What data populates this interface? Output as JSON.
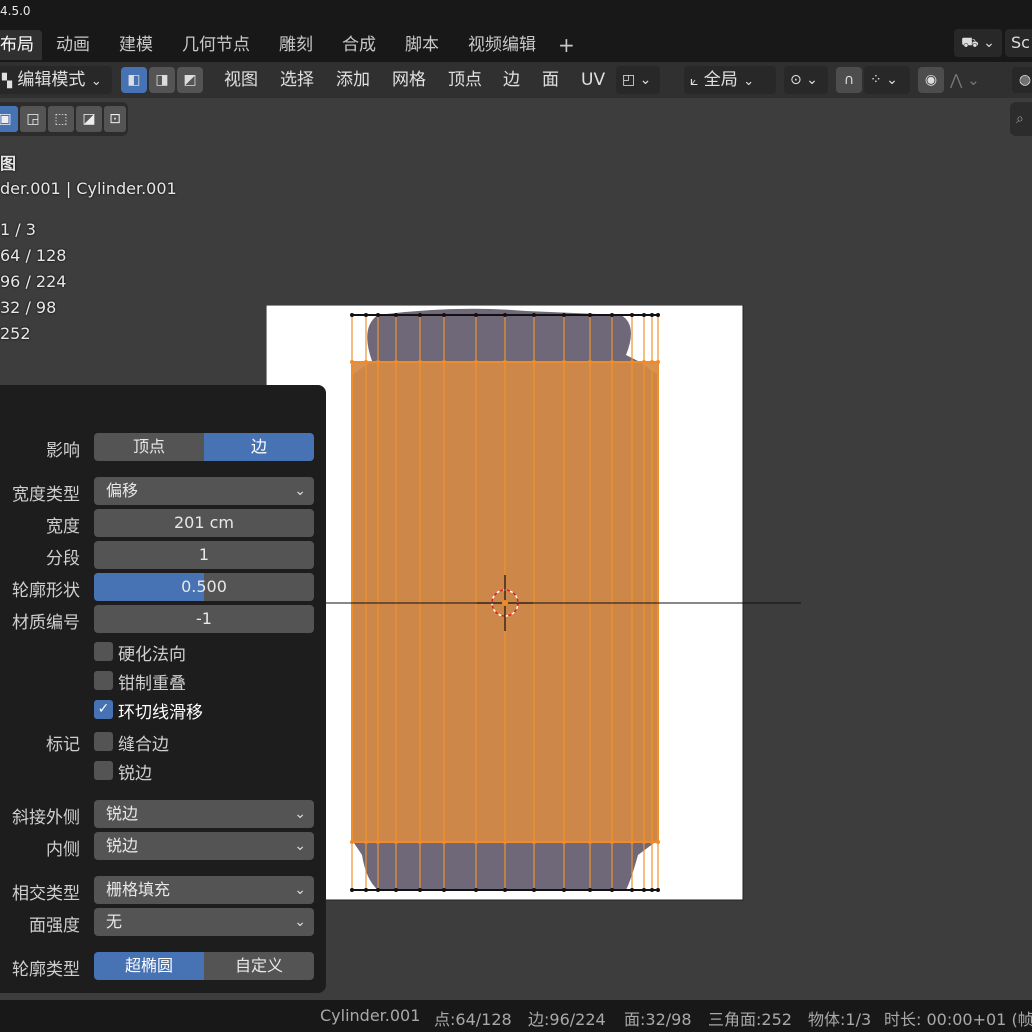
{
  "title": {
    "version": "4.5.0"
  },
  "workspace_tabs": [
    "布局",
    "动画",
    "建模",
    "几何节点",
    "雕刻",
    "合成",
    "脚本",
    "视频编辑"
  ],
  "add_workspace": "+",
  "scene_label": "Sc",
  "header": {
    "mode": "编辑模式",
    "menus": [
      "视图",
      "选择",
      "添加",
      "网格",
      "顶点",
      "边",
      "面",
      "UV"
    ],
    "transform_orientation": "全局"
  },
  "overlay": {
    "view_name": "图",
    "object_line": "der.001 | Cylinder.001",
    "stats": [
      "1 / 3",
      "64 / 128",
      "96 / 224",
      "32 / 98",
      "252"
    ]
  },
  "operator_panel": {
    "affect_label": "影响",
    "affect_options": [
      "顶点",
      "边"
    ],
    "affect_selected": "边",
    "width_type_label": "宽度类型",
    "width_type": "偏移",
    "width_label": "宽度",
    "width": "201 cm",
    "segments_label": "分段",
    "segments": "1",
    "profile_shape_label": "轮廓形状",
    "profile_shape": "0.500",
    "profile_shape_value": 0.5,
    "material_label": "材质编号",
    "material": "-1",
    "harden_normals": "硬化法向",
    "clamp_overlap": "钳制重叠",
    "loop_slide": "环切线滑移",
    "mark_label": "标记",
    "mark_seam": "缝合边",
    "mark_sharp": "锐边",
    "miter_outer_label": "斜接外侧",
    "miter_outer": "锐边",
    "miter_inner_label": "内侧",
    "miter_inner": "锐边",
    "intersection_label": "相交类型",
    "intersection": "栅格填充",
    "face_strength_label": "面强度",
    "face_strength": "无",
    "profile_type_label": "轮廓类型",
    "profile_type_options": [
      "超椭圆",
      "自定义"
    ],
    "profile_type_selected": "超椭圆",
    "checkbox_states": {
      "harden_normals": false,
      "clamp_overlap": false,
      "loop_slide": true,
      "mark_seam": false,
      "mark_sharp": false
    }
  },
  "statusbar": {
    "object": "Cylinder.001",
    "verts": "点:64/128",
    "edges": "边:96/224",
    "faces": "面:32/98",
    "tris": "三角面:252",
    "objects": "物体:1/3",
    "duration": "时长: 00:00+01 (帧"
  },
  "colors": {
    "accent_blue": "#4772b3",
    "selection_orange": "#e8882a",
    "background": "#3d3d3d"
  },
  "icons": [
    "workspace-add-icon",
    "mode-dropdown-icon",
    "vertex-select-icon",
    "edge-select-icon",
    "face-select-icon",
    "transform-orientation-icon",
    "pivot-icon",
    "snap-icon",
    "snap-target-icon",
    "proportional-edit-icon",
    "falloff-icon",
    "viewport-gizmo-icon",
    "3d-cursor-icon",
    "scene-icon"
  ]
}
